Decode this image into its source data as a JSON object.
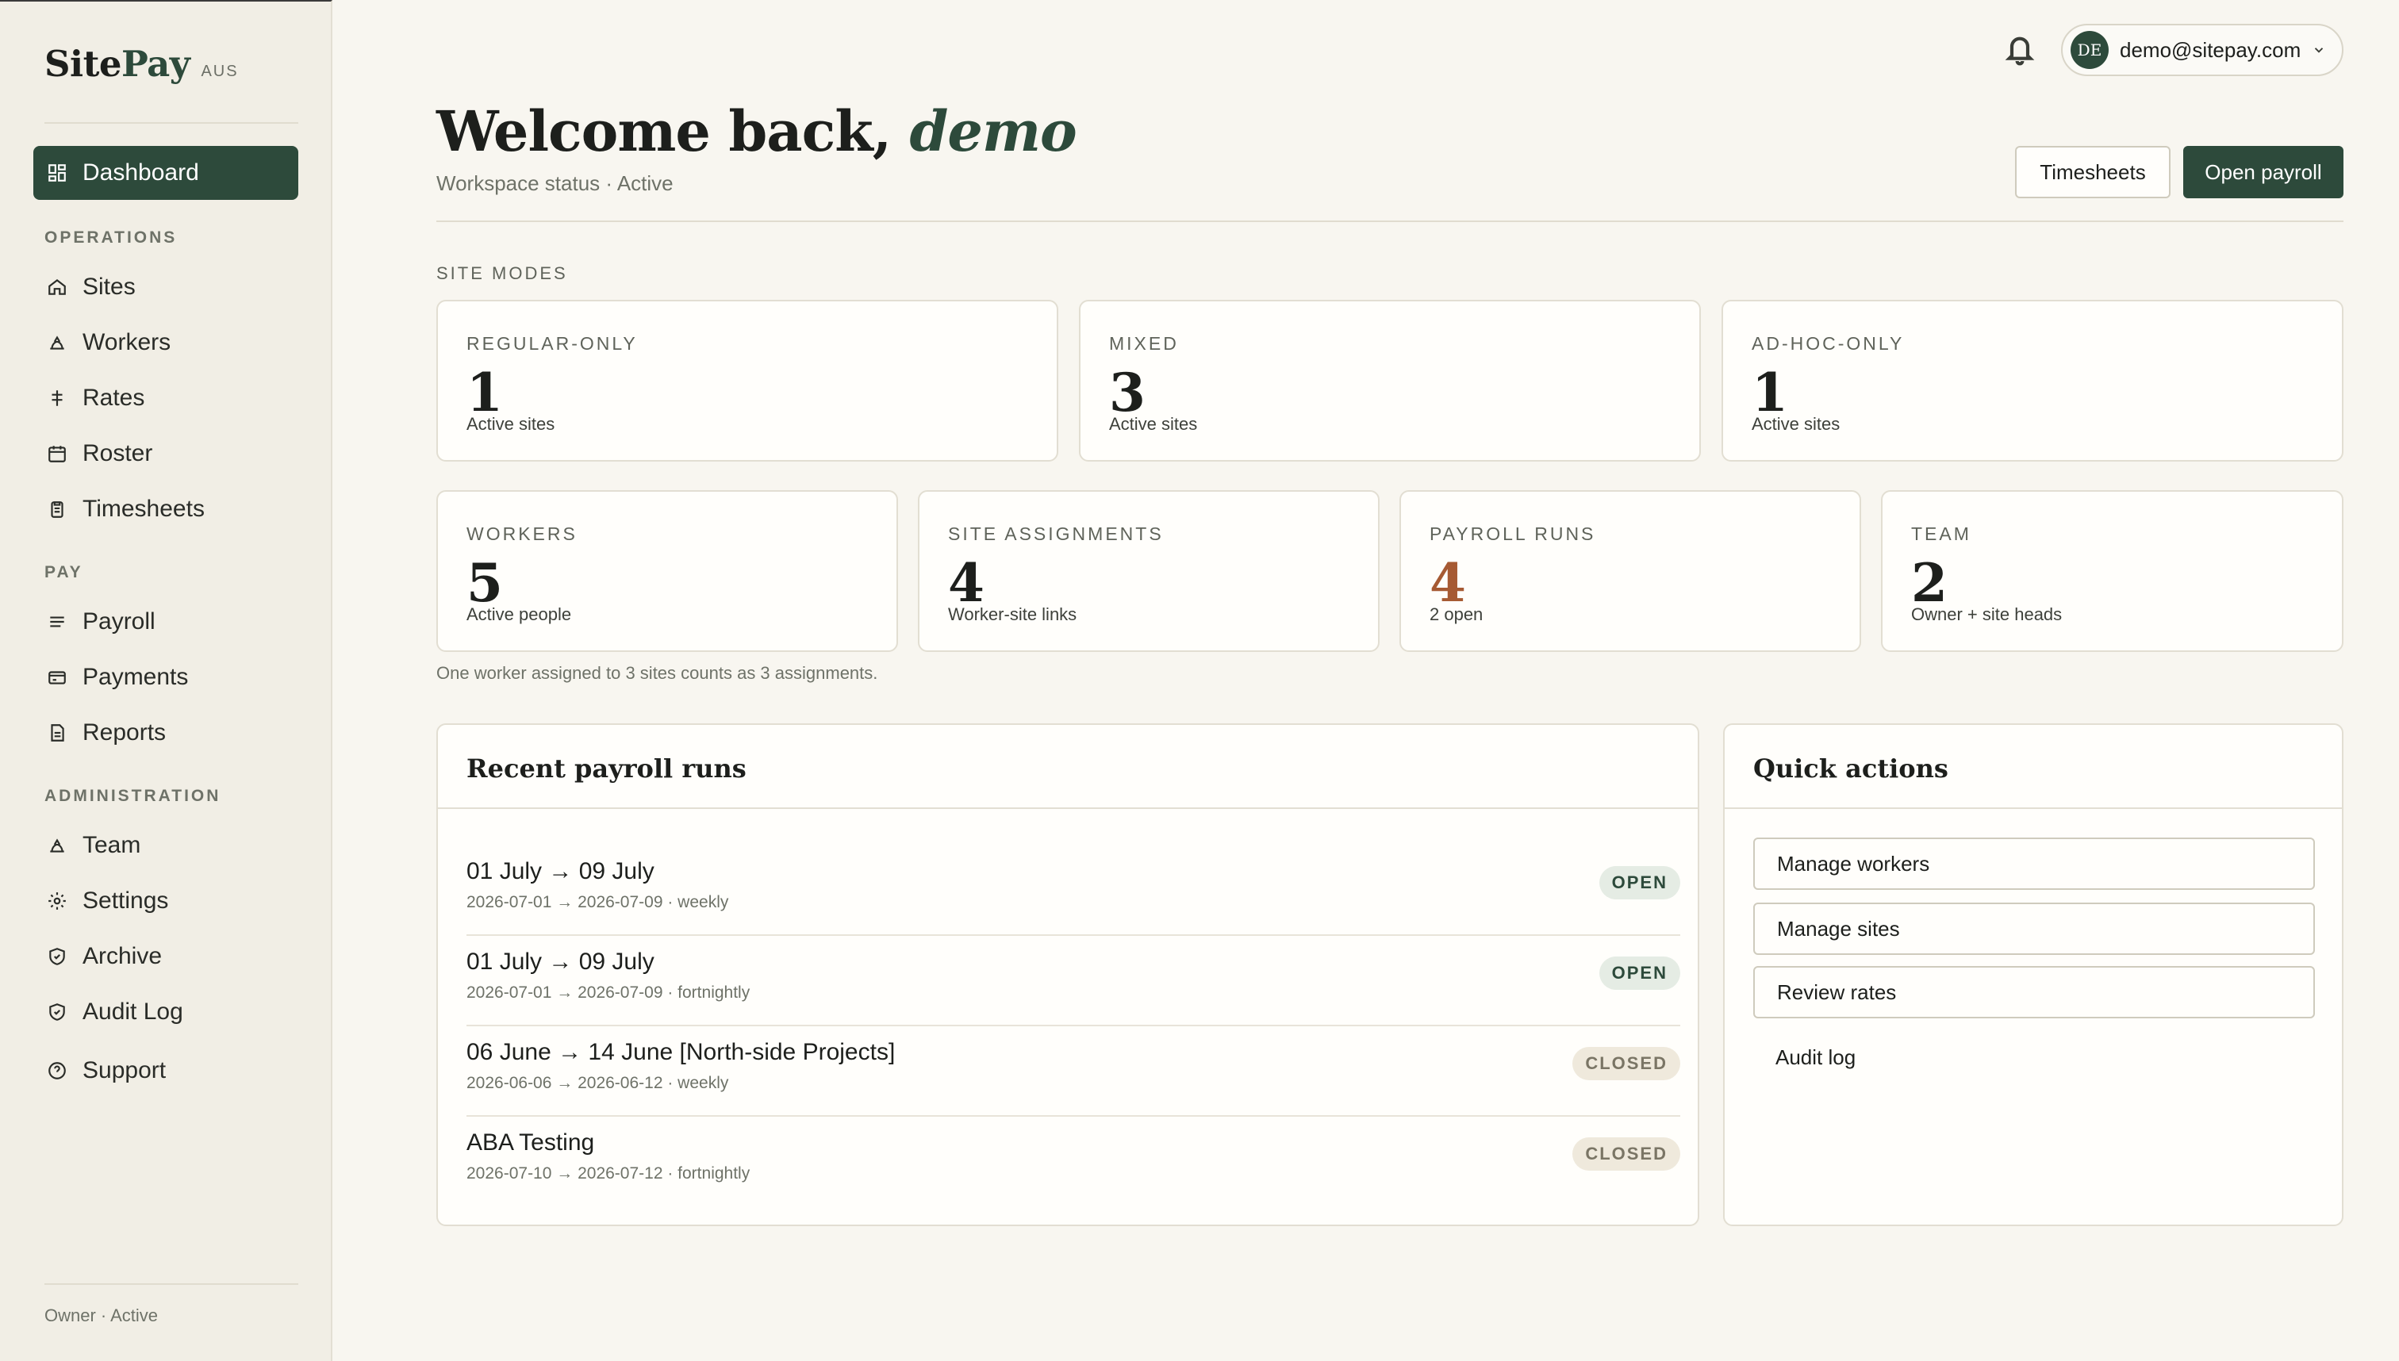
{
  "brand": {
    "name_part1": "Site",
    "name_part2": "Pay",
    "region": "AUS"
  },
  "sidebar": {
    "dashboard": "Dashboard",
    "sections": {
      "operations": "OPERATIONS",
      "pay": "PAY",
      "administration": "ADMINISTRATION"
    },
    "items": {
      "sites": "Sites",
      "workers": "Workers",
      "rates": "Rates",
      "roster": "Roster",
      "timesheets": "Timesheets",
      "payroll": "Payroll",
      "payments": "Payments",
      "reports": "Reports",
      "team": "Team",
      "settings": "Settings",
      "archive": "Archive",
      "audit_log": "Audit Log",
      "support": "Support"
    },
    "footer": "Owner · Active"
  },
  "topbar": {
    "user_initials": "DE",
    "user_email": "demo@sitepay.com"
  },
  "header": {
    "welcome_prefix": "Welcome back, ",
    "username": "demo",
    "status": "Workspace status · Active",
    "timesheets_button": "Timesheets",
    "open_payroll_button": "Open payroll"
  },
  "site_modes": {
    "label": "SITE MODES",
    "cards": [
      {
        "label": "REGULAR-ONLY",
        "value": "1",
        "sub": "Active sites"
      },
      {
        "label": "MIXED",
        "value": "3",
        "sub": "Active sites"
      },
      {
        "label": "AD-HOC-ONLY",
        "value": "1",
        "sub": "Active sites"
      }
    ]
  },
  "stats": [
    {
      "label": "WORKERS",
      "value": "5",
      "sub": "Active people"
    },
    {
      "label": "SITE ASSIGNMENTS",
      "value": "4",
      "sub": "Worker-site links"
    },
    {
      "label": "PAYROLL RUNS",
      "value": "4",
      "sub": "2 open",
      "accent": "#a65a33"
    },
    {
      "label": "TEAM",
      "value": "2",
      "sub": "Owner + site heads"
    }
  ],
  "footnote": "One worker assigned to 3 sites counts as 3 assignments.",
  "recent_runs": {
    "title": "Recent payroll runs",
    "rows": [
      {
        "title": "01 July → 09 July",
        "sub": "2026-07-01 → 2026-07-09 · weekly",
        "status": "OPEN"
      },
      {
        "title": "01 July → 09 July",
        "sub": "2026-07-01 → 2026-07-09 · fortnightly",
        "status": "OPEN"
      },
      {
        "title": "06 June → 14 June [North-side Projects]",
        "sub": "2026-06-06 → 2026-06-12 · weekly",
        "status": "CLOSED"
      },
      {
        "title": "ABA Testing",
        "sub": "2026-07-10 → 2026-07-12 · fortnightly",
        "status": "CLOSED"
      }
    ]
  },
  "quick_actions": {
    "title": "Quick actions",
    "manage_workers": "Manage workers",
    "manage_sites": "Manage sites",
    "review_rates": "Review rates",
    "audit_log": "Audit log"
  },
  "colors": {
    "brand_green": "#2d4a3b",
    "accent_rust": "#a65a33",
    "background": "#f8f6f0"
  }
}
